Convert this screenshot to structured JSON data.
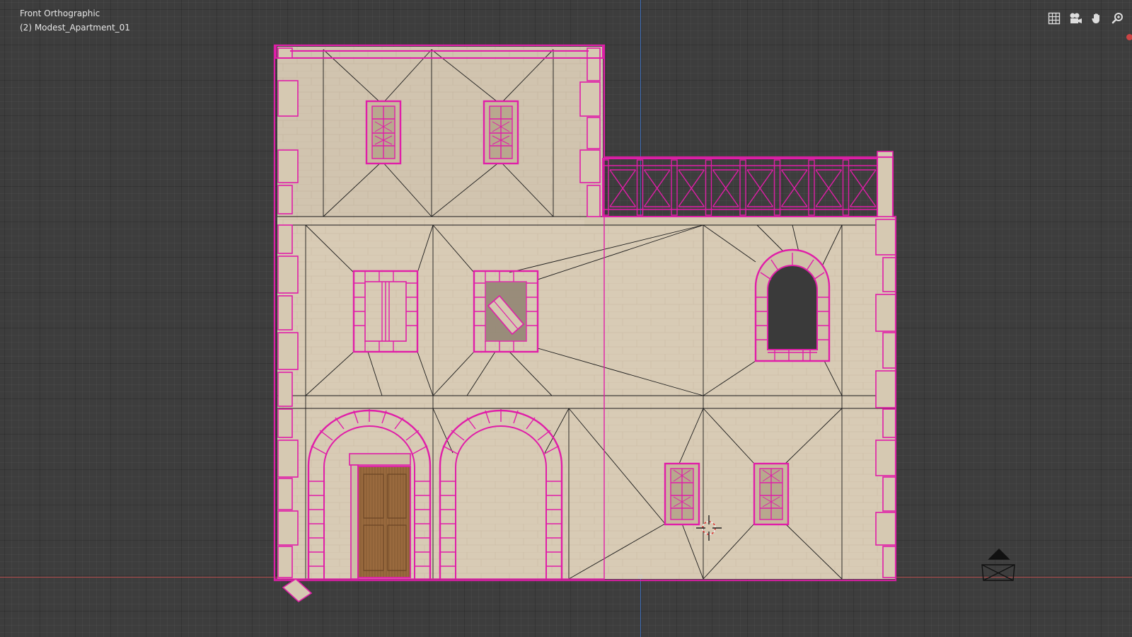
{
  "viewport": {
    "view_name": "Front Orthographic",
    "object_name": "(2) Modest_Apartment_01"
  },
  "nav_gizmos": [
    {
      "name": "toggle-ortho-grid-icon"
    },
    {
      "name": "camera-view-icon"
    },
    {
      "name": "pan-hand-icon"
    },
    {
      "name": "zoom-icon"
    }
  ],
  "colors": {
    "background": "#3d3d3d",
    "selection_outline": "#e01ea8",
    "wall": "#d8cbb5",
    "door_wood": "#9a6a3e",
    "axis_x": "#b04b4b",
    "axis_z": "#3e6eb6"
  }
}
